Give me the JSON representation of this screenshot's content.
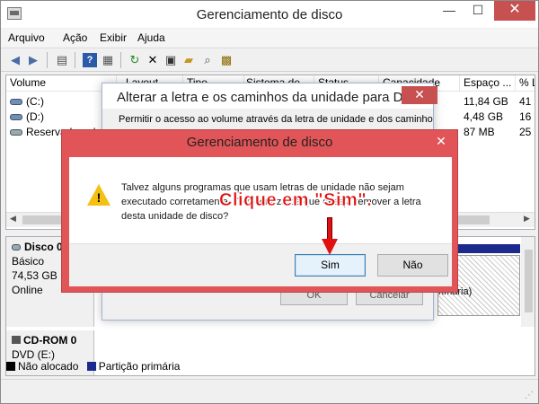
{
  "window": {
    "title": "Gerenciamento de disco",
    "controls": {
      "minimize": "—",
      "maximize": "☐",
      "close": "✕"
    }
  },
  "menubar": [
    "Arquivo",
    "Ação",
    "Exibir",
    "Ajuda"
  ],
  "toolbar": {
    "icons": [
      "back-icon",
      "forward-icon",
      "view-icon",
      "help-icon",
      "properties-icon",
      "refresh-icon",
      "delete-icon",
      "new-folder-icon",
      "open-folder-icon",
      "search-icon",
      "rescan-icon"
    ]
  },
  "volume_table": {
    "columns": [
      "Volume",
      "Layout",
      "Tipo",
      "Sistema de...",
      "Status",
      "Capacidade",
      "Espaço ...",
      "% L"
    ],
    "rows": [
      {
        "name": "(C:)",
        "free": "11,84 GB",
        "pct": "41"
      },
      {
        "name": "(D:)",
        "free": "4,48 GB",
        "pct": "16"
      },
      {
        "name": "Reservado pelo Si",
        "free": "87 MB",
        "pct": "25"
      }
    ]
  },
  "disks": [
    {
      "name": "Disco 0",
      "type": "Básico",
      "size": "74,53 GB",
      "status": "Online",
      "partition_note": "rimária)"
    },
    {
      "name": "CD-ROM 0",
      "drive": "DVD (E:)"
    }
  ],
  "legend": [
    {
      "label": "Não alocado",
      "color": "#000000"
    },
    {
      "label": "Partição primária",
      "color": "#1b2a8c"
    }
  ],
  "change_letter_dialog": {
    "title": "Alterar a letra e os caminhos da unidade para D: ()",
    "description": "Permitir o acesso ao volume através da letra de unidade e dos caminhos a",
    "ok_label": "OK",
    "cancel_label": "Cancelar"
  },
  "confirm_dialog": {
    "title": "Gerenciamento de disco",
    "close": "✕",
    "message": "Talvez alguns programas que usam letras de unidade não sejam executado corretamente. Tem certeza de que deseja remover a letra desta unidade de disco?",
    "yes_label": "Sim",
    "no_label": "Não"
  },
  "annotation": "Clique em \"Sim\".",
  "colors": {
    "accent_close": "#c75050",
    "dialog_frame": "#e15558",
    "annotation": "#e01010"
  }
}
